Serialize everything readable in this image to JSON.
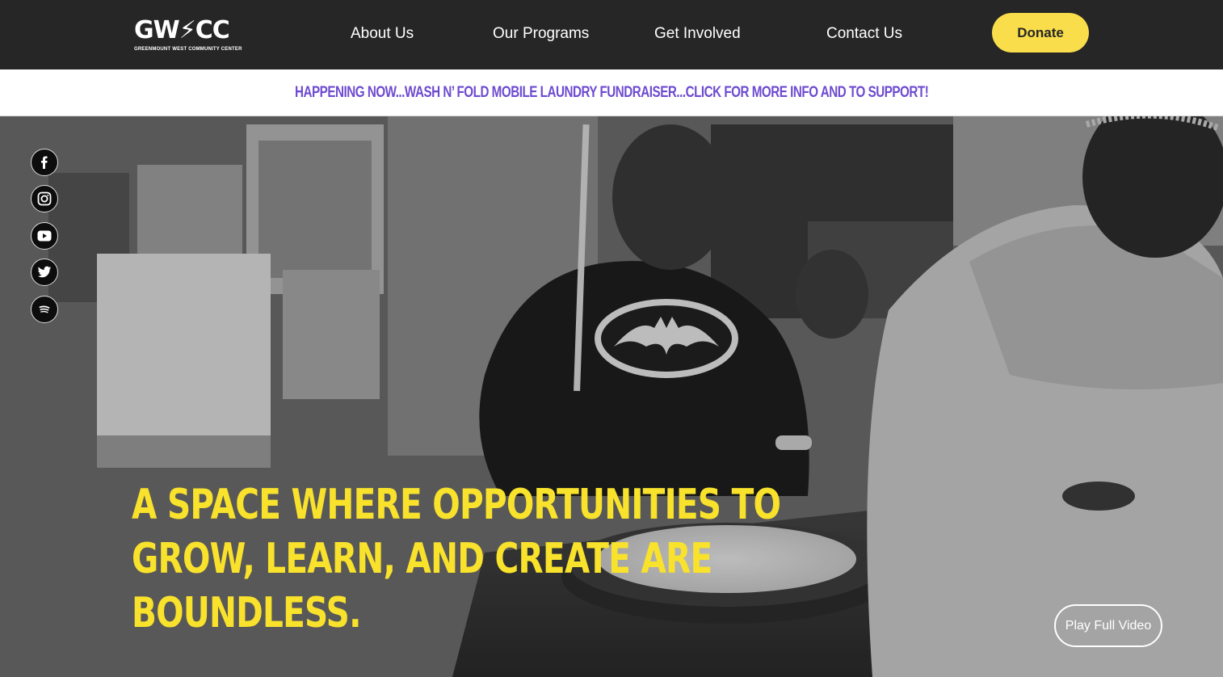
{
  "brand": {
    "logo_mark": "GW⚡CC",
    "logo_subtitle": "GREENMOUNT WEST COMMUNITY CENTER"
  },
  "nav": {
    "items": [
      {
        "label": "About Us"
      },
      {
        "label": "Our Programs"
      },
      {
        "label": "Get Involved"
      },
      {
        "label": "Contact Us"
      }
    ],
    "donate_label": "Donate"
  },
  "announcement": {
    "text": "HAPPENING NOW...WASH N’ FOLD MOBILE LAUNDRY FUNDRAISER...CLICK FOR MORE INFO AND TO SUPPORT!"
  },
  "social": [
    {
      "name": "facebook-icon",
      "glyph": "f"
    },
    {
      "name": "instagram-icon",
      "glyph": ""
    },
    {
      "name": "youtube-icon",
      "glyph": ""
    },
    {
      "name": "twitter-icon",
      "glyph": ""
    },
    {
      "name": "spotify-icon",
      "glyph": ""
    }
  ],
  "hero": {
    "headline_lines": [
      "A SPACE WHERE OPPORTUNITIES TO",
      "GROW, LEARN, AND CREATE ARE",
      "BOUNDLESS."
    ],
    "play_label": "Play Full Video"
  },
  "colors": {
    "header_bg": "#262626",
    "donate_bg": "#f9dd4b",
    "announcement_text": "#6e4bd0",
    "headline": "#f9e22c"
  }
}
